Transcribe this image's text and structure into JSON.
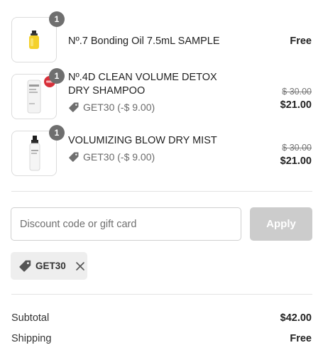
{
  "line_items": [
    {
      "quantity": "1",
      "name": "Nº.7 Bonding Oil 7.5mL SAMPLE",
      "discount_label": "",
      "original_price": "",
      "price": "Free",
      "image_icon": "oil-bottle-icon"
    },
    {
      "quantity": "1",
      "name": "Nº.4D CLEAN VOLUME DETOX DRY SHAMPOO",
      "discount_label": "GET30 (-$ 9.00)",
      "original_price": "$ 30.00",
      "price": "$21.00",
      "image_icon": "dry-shampoo-bottle-icon"
    },
    {
      "quantity": "1",
      "name": "VOLUMIZING BLOW DRY MIST",
      "discount_label": "GET30 (-$ 9.00)",
      "original_price": "$ 30.00",
      "price": "$21.00",
      "image_icon": "mist-spray-bottle-icon"
    }
  ],
  "discount": {
    "placeholder": "Discount code or gift card",
    "value": "",
    "apply_label": "Apply",
    "applied_code": "GET30"
  },
  "summary": {
    "subtotal_label": "Subtotal",
    "subtotal_value": "$42.00",
    "shipping_label": "Shipping",
    "shipping_value": "Free"
  },
  "colors": {
    "badge": "#6f6f6f",
    "apply_disabled": "#cccccc",
    "chip_bg": "#eeeeee",
    "muted_text": "#6a6a6a"
  }
}
